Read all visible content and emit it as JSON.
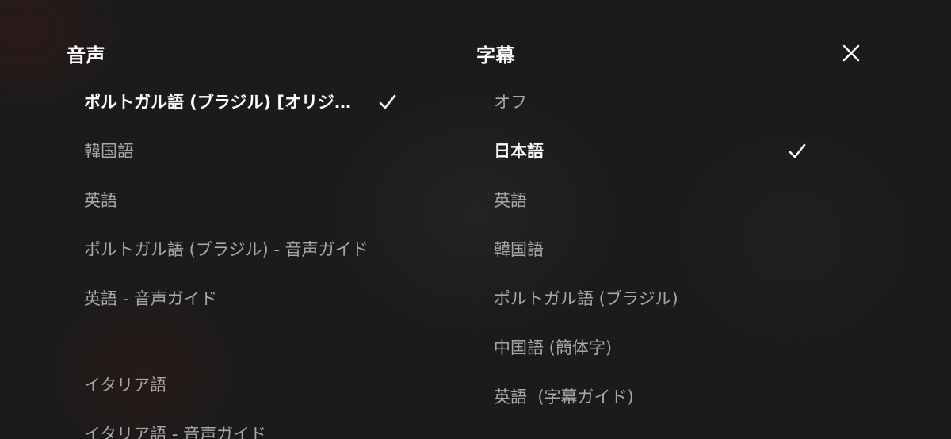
{
  "audio": {
    "title": "音声",
    "options": [
      {
        "label": "ポルトガル語 (ブラジル) [オリジ…",
        "selected": true
      },
      {
        "label": "韓国語",
        "selected": false
      },
      {
        "label": "英語",
        "selected": false
      },
      {
        "label": "ポルトガル語 (ブラジル) - 音声ガイド",
        "selected": false
      },
      {
        "label": "英語 - 音声ガイド",
        "selected": false
      },
      {
        "label": "イタリア語",
        "selected": false
      },
      {
        "label": "イタリア語 - 音声ガイド",
        "selected": false
      }
    ]
  },
  "subtitles": {
    "title": "字幕",
    "options": [
      {
        "label": "オフ",
        "selected": false
      },
      {
        "label": "日本語",
        "selected": true
      },
      {
        "label": "英語",
        "selected": false
      },
      {
        "label": "韓国語",
        "selected": false
      },
      {
        "label": "ポルトガル語 (ブラジル)",
        "selected": false
      },
      {
        "label": "中国語 (簡体字)",
        "selected": false
      },
      {
        "label": "英語  (字幕ガイド)",
        "selected": false
      }
    ]
  },
  "icons": {
    "close": "close-icon",
    "check": "check-icon"
  },
  "colors": {
    "background": "#1b1b1b",
    "selected_text": "#ffffff",
    "unselected_text": "#a8a8a8",
    "divider": "#6a6a6a"
  }
}
